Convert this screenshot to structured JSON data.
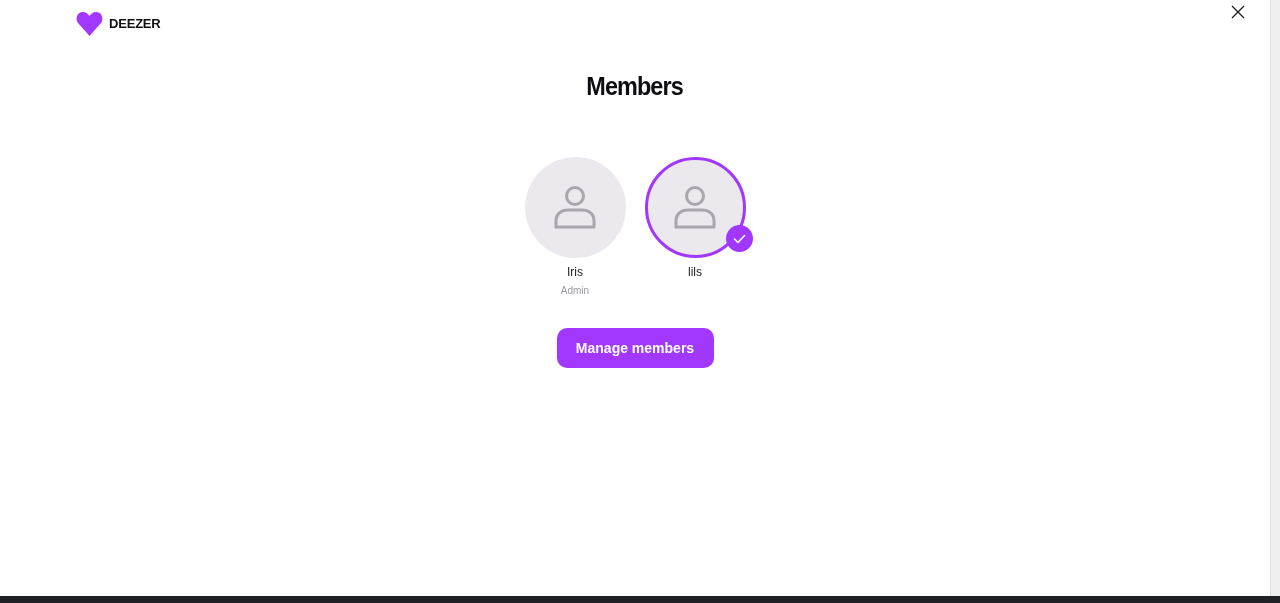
{
  "header": {
    "logo_text": "DEEZER"
  },
  "title": "Members",
  "members": [
    {
      "name": "Iris",
      "role": "Admin",
      "selected": false
    },
    {
      "name": "lils",
      "selected": true
    }
  ],
  "button": {
    "label": "Manage members"
  }
}
